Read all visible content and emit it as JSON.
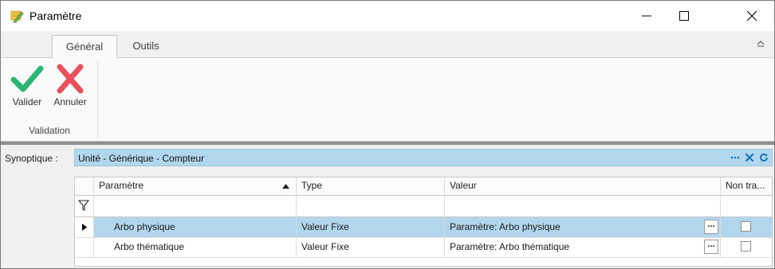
{
  "window": {
    "title": "Paramètre",
    "icon": "pencil-ruler-icon"
  },
  "ribbon": {
    "tabs": [
      {
        "label": "Général",
        "active": true
      },
      {
        "label": "Outils",
        "active": false
      }
    ],
    "buttons": [
      {
        "label": "Valider",
        "icon": "checkmark-icon",
        "color": "#2bb673"
      },
      {
        "label": "Annuler",
        "icon": "cross-icon",
        "color": "#e8505b"
      }
    ],
    "group_label": "Validation"
  },
  "synoptique": {
    "label": "Synoptique :",
    "value": "Unité - Générique - Compteur"
  },
  "grid": {
    "columns": [
      "Paramètre",
      "Type",
      "Valeur",
      "Non tra..."
    ],
    "sorted_column": "Paramètre",
    "rows": [
      {
        "parametre": "Arbo physique",
        "type": "Valeur Fixe",
        "valeur": "Paramètre: Arbo physique",
        "non_traite": false,
        "selected": true
      },
      {
        "parametre": "Arbo thématique",
        "type": "Valeur Fixe",
        "valeur": "Paramètre: Arbo thématique",
        "non_traite": false,
        "selected": false
      }
    ],
    "ellipsis_label": "..."
  },
  "colors": {
    "selection": "#b2d7ed",
    "accent_icon": "#1e73be"
  }
}
